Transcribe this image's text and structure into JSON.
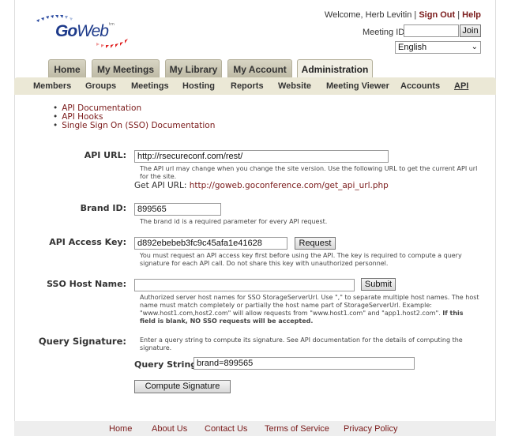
{
  "header": {
    "logo_text_go": "Go",
    "logo_text_web": "Web",
    "logo_tm": "tm",
    "welcome": "Welcome, Herb Levitin |",
    "sign_out": "Sign Out",
    "separator": "|",
    "help": "Help",
    "meeting_id_label": "Meeting ID:",
    "meeting_id_value": "",
    "join": "Join",
    "language": "English"
  },
  "tabs": [
    {
      "label": "Home"
    },
    {
      "label": "My Meetings"
    },
    {
      "label": "My Library"
    },
    {
      "label": "My Account"
    },
    {
      "label": "Administration",
      "active": true
    }
  ],
  "subnav": [
    {
      "label": "Members"
    },
    {
      "label": "Groups"
    },
    {
      "label": "Meetings"
    },
    {
      "label": "Hosting"
    },
    {
      "label": "Reports"
    },
    {
      "label": "Website"
    },
    {
      "label": "Meeting Viewer"
    },
    {
      "label": "Accounts"
    },
    {
      "label": "API",
      "active": true
    }
  ],
  "doc_links": [
    "API Documentation",
    "API Hooks",
    "Single Sign On (SSO) Documentation"
  ],
  "form": {
    "api_url": {
      "label": "API URL:",
      "value": "http://rsecureconf.com/rest/",
      "help": "The API url may change when you change the site version. Use the following URL to get the current API url for the site.",
      "get_label": "Get API URL:",
      "get_link": "http://goweb.goconference.com/get_api_url.php"
    },
    "brand_id": {
      "label": "Brand ID:",
      "value": "899565",
      "help": "The brand id is a required parameter for every API request."
    },
    "access_key": {
      "label": "API Access Key:",
      "value": "d892ebebeb3fc9c45afa1e41628",
      "button": "Request",
      "help": "You must request an API access key first before using the API. The key is required to compute a query signature for each API call. Do not share this key with unauthorized personnel."
    },
    "sso_host": {
      "label": "SSO Host Name:",
      "value": "",
      "button": "Submit",
      "help": "Authorized server host names for SSO StorageServerUrl. Use \",\" to separate multiple host names. The host name must match completely or partially the host name part of StorageServerUrl. Example: \"www.host1.com,host2.com\" will allow requests from \"www.host1.com\" and \"app1.host2.com\".",
      "help_bold": "If this field is blank, NO SSO requests will be accepted."
    },
    "query_signature": {
      "label": "Query Signature:",
      "help": "Enter a query string to compute its signature. See API documentation for the details of computing the signature.",
      "qs_label": "Query String:",
      "qs_value": "brand=899565",
      "button": "Compute Signature"
    }
  },
  "footer": [
    "Home",
    "About Us",
    "Contact Us",
    "Terms of Service",
    "Privacy Policy"
  ],
  "colors": {
    "link": "#7a1a1a",
    "tab": "#c9c5b0",
    "subnav": "#ebe8d6"
  }
}
